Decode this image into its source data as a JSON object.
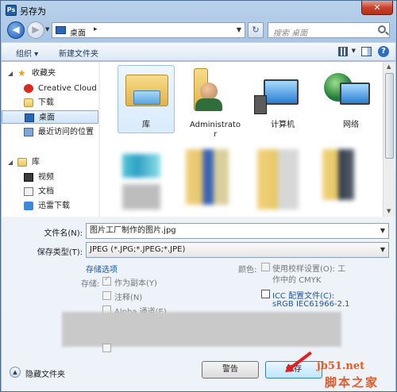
{
  "window": {
    "title": "另存为",
    "app_icon_letter": "Ps",
    "close_glyph": "✕"
  },
  "nav": {
    "back_glyph": "◀",
    "fwd_glyph": "▶",
    "address_location": "桌面",
    "address_separator": "▸",
    "refresh_glyph": "↻",
    "search_placeholder": "搜索 桌面"
  },
  "toolbar": {
    "organize_label": "组织 ▾",
    "new_folder_label": "新建文件夹"
  },
  "sidebar": {
    "items": [
      {
        "label": "收藏夹",
        "icon": "star-icon",
        "type": "head"
      },
      {
        "label": "Creative Cloud",
        "icon": "creative-cloud-icon"
      },
      {
        "label": "下载",
        "icon": "download-folder-icon"
      },
      {
        "label": "桌面",
        "icon": "desktop-icon",
        "selected": true
      },
      {
        "label": "最近访问的位置",
        "icon": "recent-places-icon"
      },
      {
        "label": "库",
        "icon": "library-icon",
        "type": "head"
      },
      {
        "label": "视频",
        "icon": "video-icon"
      },
      {
        "label": "文档",
        "icon": "documents-icon"
      },
      {
        "label": "迅雷下载",
        "icon": "thunder-download-icon"
      }
    ]
  },
  "files": [
    {
      "name": "库",
      "icon": "library-folder-icon",
      "selected": true
    },
    {
      "name": "Administrator",
      "icon": "user-folder-icon"
    },
    {
      "name": "计算机",
      "icon": "computer-icon"
    },
    {
      "name": "网络",
      "icon": "network-icon"
    }
  ],
  "form": {
    "filename_label": "文件名(N):",
    "filename_value": "图片工厂制作的图片.jpg",
    "filetype_label": "保存类型(T):",
    "filetype_value": "JPEG (*.JPG;*.JPEG;*.JPE)",
    "save_options_link": "存储选项",
    "storage_label": "存储:",
    "as_copy_label": "作为副本(Y)",
    "annotation_label": "注释(N)",
    "alpha_label": "Alpha 通道(E)",
    "color_label": "颜色:",
    "proof_setup_line1": "使用校样设置(O): 工",
    "proof_setup_line2": "作中的 CMYK",
    "icc_label": "ICC 配置文件(C):",
    "icc_value": "sRGB IEC61966-2.1"
  },
  "footer": {
    "hide_folders_label": "隐藏文件夹",
    "warning_button": "警告",
    "save_button": "保存"
  },
  "watermark": {
    "line1": "jb51.net",
    "line2": "脚本之家"
  }
}
